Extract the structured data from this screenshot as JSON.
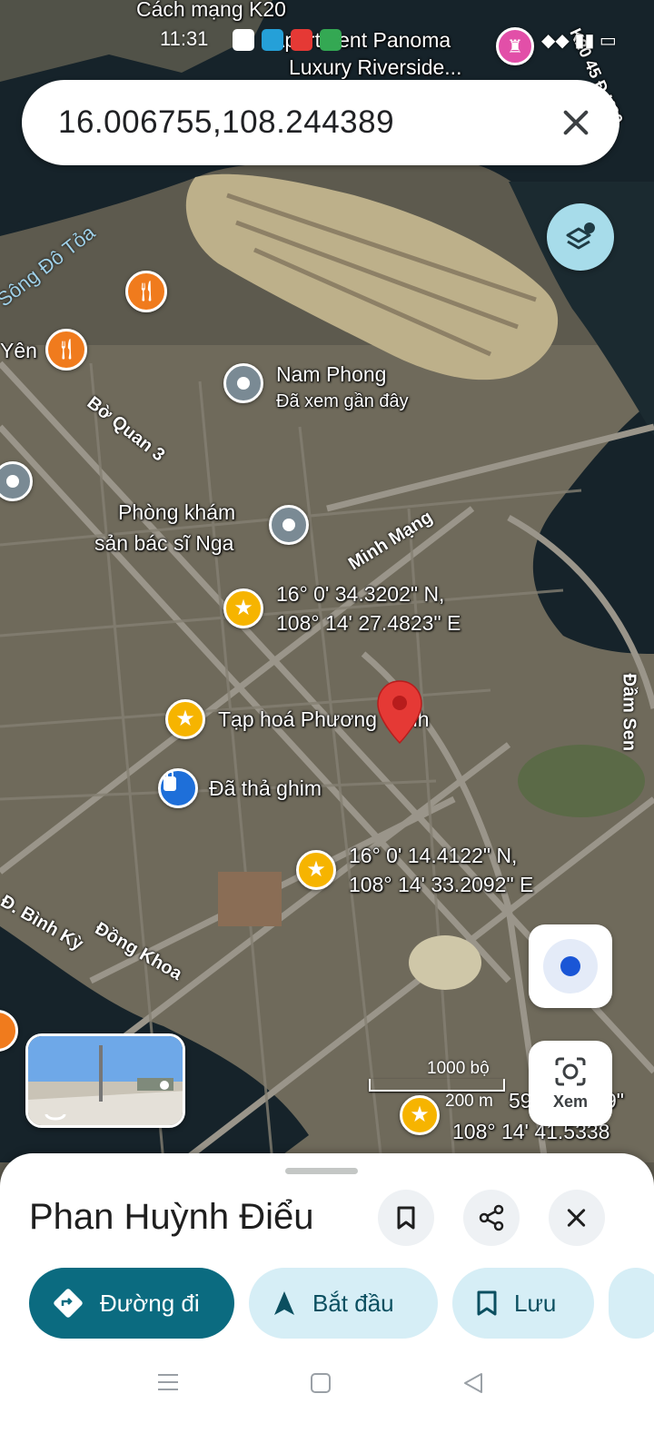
{
  "status_bar": {
    "time": "11:31",
    "right": "◆◆ ▮▮ ▭"
  },
  "search": {
    "query": "16.006755,108.244389"
  },
  "map": {
    "top_labels": {
      "cach_mang": "Cách mạng K20",
      "apartment": "Apartment Panoma",
      "luxury": "Luxury Riverside...",
      "k20": "K20 45 Đ.K20"
    },
    "river": "Sông Đô Tỏa",
    "left_edge": "Yên",
    "streets": {
      "bo_quan": "Bờ Quan 3",
      "minh_mang": "Minh Mạng",
      "binh_ky": "Đ. Bình Kỳ",
      "dong_khoa": "Đồng Khoa",
      "dam_sen": "Đầm Sen"
    },
    "places": {
      "nam_phong": "Nam Phong",
      "nam_phong_sub": "Đã xem gần đây",
      "phong_kham_1": "Phòng khám",
      "phong_kham_2": "sản bác sĩ Nga",
      "coord1_a": "16° 0' 34.3202\" N,",
      "coord1_b": "108° 14' 27.4823\" E",
      "tap_hoa": "Tạp hoá Phương Trinh",
      "dropped_pin": "Đã thả ghim",
      "coord2_a": "16° 0' 14.4122\" N,",
      "coord2_b": "108° 14' 33.2092\" E",
      "coord3_a": "59",
      "coord3_a_end": "9\"",
      "coord3_b": "108° 14' 41.5338"
    },
    "scale": {
      "feet": "1000 bộ",
      "meters": "200 m"
    }
  },
  "controls": {
    "lens_label": "Xem"
  },
  "sheet": {
    "title": "Phan Huỳnh Điểu",
    "actions": [
      {
        "label": "Đường đi",
        "icon": "directions-icon"
      },
      {
        "label": "Bắt đầu",
        "icon": "navigation-arrow-icon"
      },
      {
        "label": "Lưu",
        "icon": "bookmark-icon"
      }
    ]
  },
  "colors": {
    "primary": "#0b6b80",
    "chip_light": "#d6eef6",
    "pin_red": "#e53935",
    "star": "#f6b400"
  }
}
